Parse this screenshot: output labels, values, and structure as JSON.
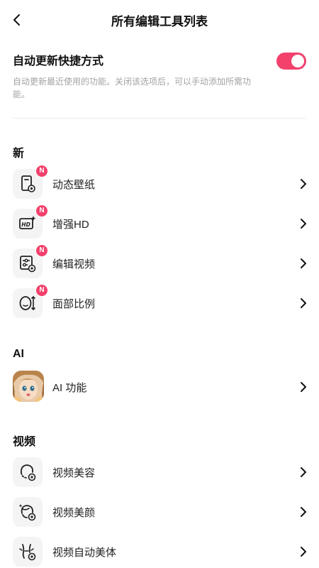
{
  "header": {
    "title": "所有编辑工具列表"
  },
  "auto_update": {
    "title": "自动更新快捷方式",
    "description": "自动更新最近使用的功能。关闭该选项后，可以手动添加所需功能。",
    "enabled": true
  },
  "sections": [
    {
      "title": "新",
      "items": [
        {
          "label": "动态壁纸",
          "icon": "phone-wallpaper-icon",
          "badge": "N"
        },
        {
          "label": "增强HD",
          "icon": "hd-enhance-icon",
          "badge": "N"
        },
        {
          "label": "编辑视频",
          "icon": "edit-video-icon",
          "badge": "N"
        },
        {
          "label": "面部比例",
          "icon": "face-ratio-icon",
          "badge": "N"
        }
      ]
    },
    {
      "title": "AI",
      "items": [
        {
          "label": "AI 功能",
          "icon": "ai-avatar-image"
        }
      ]
    },
    {
      "title": "视频",
      "items": [
        {
          "label": "视频美容",
          "icon": "video-beauty-icon"
        },
        {
          "label": "视频美颜",
          "icon": "video-face-beauty-icon"
        },
        {
          "label": "视频自动美体",
          "icon": "video-auto-body-icon"
        }
      ]
    }
  ],
  "colors": {
    "accent": "#f2416b",
    "icon_bg": "#f4f4f4",
    "divider": "#ececec",
    "desc_text": "#a3a3a3"
  }
}
